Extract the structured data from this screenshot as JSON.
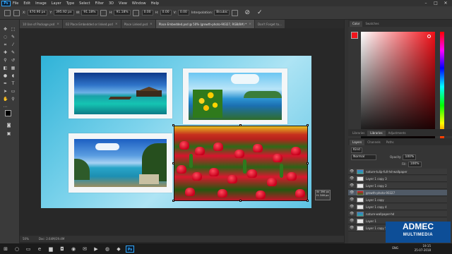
{
  "app": {
    "logo": "Ps"
  },
  "menu": [
    "File",
    "Edit",
    "Image",
    "Layer",
    "Type",
    "Select",
    "Filter",
    "3D",
    "View",
    "Window",
    "Help"
  ],
  "window_controls": [
    "–",
    "□",
    "✕"
  ],
  "options_bar": {
    "x_label": "X:",
    "x_value": "470.90 px",
    "y_label": "Y:",
    "y_value": "395.92 px",
    "w_label": "W:",
    "w_value": "91.18%",
    "h_label": "H:",
    "h_value": "91.18%",
    "angle_value": "0.00",
    "h_skew_label": "H:",
    "h_skew_value": "0.00",
    "v_skew_label": "V:",
    "v_skew_value": "0.00",
    "interp_label": "Interpolation:",
    "interp_value": "Bicubic",
    "cancel_symbol": "⊘",
    "commit_symbol": "✓"
  },
  "tabs": [
    {
      "label": "10 Use of Package.psd",
      "active": false
    },
    {
      "label": "02 Place Embedded or linked.psd",
      "active": false
    },
    {
      "label": "Place Linked.psd",
      "active": false
    },
    {
      "label": "Place Embedded.psd @ 50% (growth-photo-90327, RGB/8#) *",
      "active": true
    },
    {
      "label": "Don't Forget to...",
      "active": false
    }
  ],
  "tab_close": "×",
  "canvas_info": {
    "dim_w": "W: 396 px",
    "dim_h": "H: 346 px"
  },
  "status_bar": {
    "zoom": "50%",
    "doc": "Doc: 2.64M/29.4M"
  },
  "color_panel": {
    "tabs": [
      "Color",
      "Swatches"
    ],
    "foreground": "#f1141c"
  },
  "libraries_panel": {
    "tabs": [
      "Libraries",
      "Libraries",
      "Adjustments"
    ]
  },
  "layers_panel": {
    "tabs": [
      "Layers",
      "Channels",
      "Paths"
    ],
    "filter_label": "Kind",
    "blend_label": "Normal",
    "opacity_label": "Opacity:",
    "opacity_value": "100%",
    "fill_label": "Fill:",
    "fill_value": "100%",
    "layers": [
      {
        "name": "nature-tulip-full-hd-wallpaper",
        "thumb": "img",
        "selected": false
      },
      {
        "name": "Layer 1 copy 3",
        "thumb": "blank",
        "selected": false
      },
      {
        "name": "Layer 1 copy 2",
        "thumb": "blank",
        "selected": false
      },
      {
        "name": "growth-photo-90327",
        "thumb": "red",
        "selected": true
      },
      {
        "name": "Layer 1 copy",
        "thumb": "blank",
        "selected": false
      },
      {
        "name": "Layer 1 copy 4",
        "thumb": "blank",
        "selected": false
      },
      {
        "name": "nature-wallpaper-hd",
        "thumb": "img",
        "selected": false
      },
      {
        "name": "Layer 1",
        "thumb": "blank",
        "selected": false
      },
      {
        "name": "Layer 1 copy 5",
        "thumb": "blank",
        "selected": false
      }
    ]
  },
  "badge": {
    "title": "ADMEC",
    "subtitle": "MULTIMEDIA"
  },
  "taskbar": {
    "icons": [
      "windows-icon",
      "search-icon",
      "task-view-icon",
      "edge-icon",
      "folder-icon",
      "store-icon",
      "chrome-icon",
      "mail-icon",
      "video-icon",
      "firefox-icon",
      "illustrator-icon"
    ],
    "ps_label": "Ps",
    "lang": "ENG",
    "time": "19:15",
    "date": "25-07-2018"
  }
}
